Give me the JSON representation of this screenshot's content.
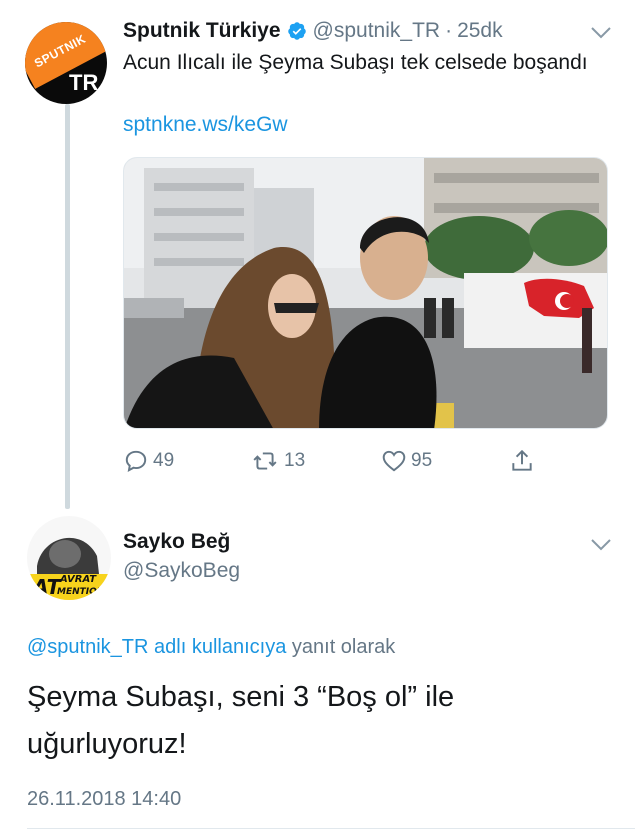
{
  "tweet1": {
    "display_name": "Sputnik Türkiye",
    "handle": "@sputnik_TR",
    "separator": "·",
    "time": "25dk",
    "text": "Acun Ilıcalı ile Şeyma Subaşı tek celsede boşandı",
    "link": "sptnkne.ws/keGw",
    "avatar": {
      "icon": "sputnik-tr-logo",
      "brand_text": "SPUTNIK",
      "letters": "TR"
    },
    "verified_icon": "verified-badge-icon",
    "menu_icon": "chevron-down-icon",
    "media": {
      "description_icon": "photo"
    },
    "actions": {
      "reply_count": "49",
      "retweet_count": "13",
      "like_count": "95",
      "share_icon": "share-icon"
    }
  },
  "tweet2": {
    "display_name": "Sayko Beğ",
    "handle": "@SaykoBeg",
    "avatar": {
      "icon": "atmention-avatar",
      "logo_text": "AT AVRAT MENTION"
    },
    "menu_icon": "chevron-down-icon",
    "replying_to_handle": "@sputnik_TR",
    "replying_to_text": "adlı kullanıcıya",
    "replying_to_suffix": "yanıt olarak",
    "text": "Şeyma Subaşı, seni 3 “Boş ol” ile uğurluyoruz!",
    "timestamp": "26.11.2018 14:40"
  },
  "colors": {
    "link": "#1b95e0",
    "secondary_text": "#657786",
    "primary_text": "#14171a",
    "verified": "#1da1f2",
    "sputnik_orange": "#f5821f"
  }
}
